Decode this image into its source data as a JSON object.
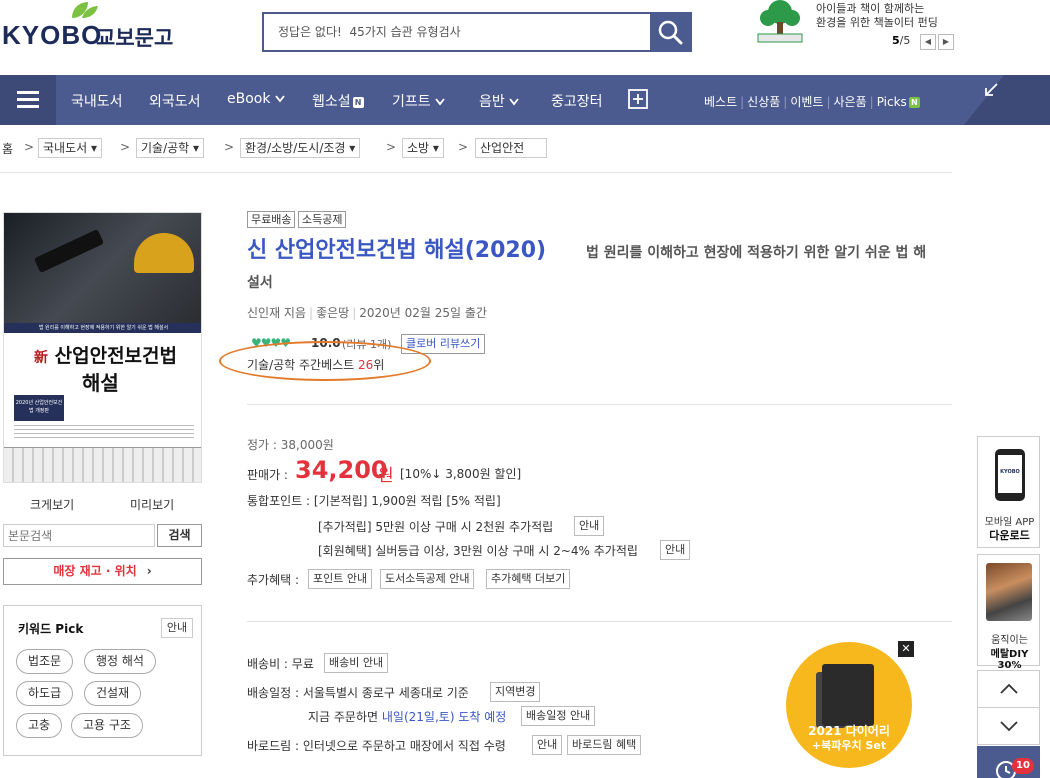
{
  "header": {
    "logo_en": "KYOBO",
    "logo_ko": "교보문고",
    "search_placeholder": "정답은 없다!  45가지 습관 유형검사",
    "banner_line1": "아이들과 책이 함께하는",
    "banner_line2": "환경을 위한 책놀이터 펀딩",
    "banner_page_current": "5",
    "banner_page_total": "/5",
    "banner_prev": "◀",
    "banner_next": "▶"
  },
  "nav": {
    "items": [
      "국내도서",
      "외국도서",
      "eBook",
      "웹소설",
      "기프트",
      "음반",
      "중고장터"
    ],
    "sub_items": [
      "베스트",
      "신상품",
      "이벤트",
      "사은품",
      "Picks"
    ],
    "n_badge": "N",
    "sub_sep": "|"
  },
  "breadcrumb": {
    "home": "홈",
    "levels": [
      "국내도서",
      "기술/공학",
      "환경/소방/도시/조경",
      "소방",
      "산업안전"
    ],
    "sep": ">"
  },
  "cover": {
    "band_text": "법 원리를 이해하고 현장에 적용하기 위한 알기 쉬운 법 해설서",
    "title_prefix": "新",
    "title_line1": "산업안전보건법",
    "title_line2": "해설",
    "mini_text": "2020년 산업안전보건법 개정판"
  },
  "left": {
    "zoom_label": "크게보기",
    "preview_label": "미리보기",
    "fulltext_placeholder": "본문검색",
    "fulltext_button": "검색",
    "stock_button": "매장 재고 · 위치",
    "stock_chev": "›",
    "keyword_title": "키워드 Pick",
    "keyword_info": "안내",
    "keywords": [
      "법조문",
      "행정 해석",
      "하도급",
      "건설재",
      "고충",
      "고용 구조"
    ]
  },
  "product": {
    "tags": [
      "무료배송",
      "소득공제"
    ],
    "title": "신 산업안전보건법 해설(2020)",
    "subtitle": "법 원리를 이해하고 현장에 적용하기 위한 알기 쉬운 법 해",
    "subtitle_cont": "설서",
    "author": "신인재 지음",
    "publisher": "좋은땅",
    "date": "2020년 02월 25일 출간",
    "meta_sep": "|",
    "hearts": "♥♥♥♥",
    "rating": "10.0",
    "review_count": "(리뷰 1개)",
    "review_button": "클로버 리뷰쓰기",
    "rank_prefix": "기술/공학 주간베스트",
    "rank_num": "26",
    "rank_suffix": "위"
  },
  "pricing": {
    "list_label": "정가 :",
    "list_price": "38,000원",
    "sale_label": "판매가 :",
    "sale_price": "34,200",
    "sale_unit": "원",
    "discount": "[10%↓ 3,800원 할인]",
    "points_label": "통합포인트 :",
    "points_basic": "[기본적립] 1,900원 적립 [5% 적립]",
    "points_extra": "[추가적립] 5만원 이상 구매 시 2천원 추가적립",
    "points_member": "[회원혜택] 실버등급 이상, 3만원 이상 구매 시 2~4% 추가적립",
    "info_button": "안내",
    "benefit_label": "추가혜택 :",
    "benefit_buttons": [
      "포인트 안내",
      "도서소득공제 안내",
      "추가혜택 더보기"
    ]
  },
  "shipping": {
    "fee_label": "배송비 : 무료",
    "fee_button": "배송비 안내",
    "schedule_label": "배송일정 : 서울특별시 종로구 세종대로 기준",
    "region_button": "지역변경",
    "order_now_prefix": "지금 주문하면",
    "order_now_date": "내일(21일,토) 도착 예정",
    "schedule_button": "배송일정 안내",
    "barodrim": "바로드림 : 인터넷으로 주문하고 매장에서 직접 수령",
    "info_button": "안내",
    "barodrim_button": "바로드림 혜택"
  },
  "sidebar": {
    "app_line1": "모바일 APP",
    "app_line2": "다운로드",
    "ad_line1": "움직이는",
    "ad_line2": "메탈DIY 30%",
    "recent_count": "10",
    "phone_brand": "KYOBO"
  },
  "promo": {
    "line1": "2021 다이어리",
    "line2": "+북파우치 Set",
    "close": "✕"
  },
  "colors": {
    "brand": "#4c5b8f",
    "title_blue": "#3a57c4",
    "price_red": "#e4323c",
    "heart_green": "#38b37a",
    "highlight_ring": "#e27a2c"
  }
}
